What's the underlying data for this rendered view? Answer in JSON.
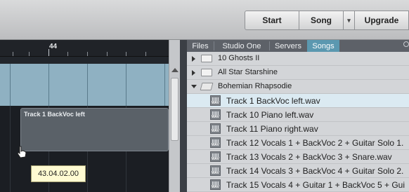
{
  "toolbar": {
    "start_label": "Start",
    "song_label": "Song",
    "dropdown_glyph": "▾",
    "upgrade_label": "Upgrade"
  },
  "timeline": {
    "ruler_label": "44",
    "clip_label": "Track 1 BackVoc left",
    "tooltip": "43.04.02.00"
  },
  "browser": {
    "tabs": [
      {
        "label": "Files"
      },
      {
        "label": "Studio One"
      },
      {
        "label": "Servers"
      },
      {
        "label": "Songs",
        "active": true
      }
    ],
    "folders": [
      {
        "label": "10 Ghosts II",
        "expanded": false
      },
      {
        "label": "All Star Starshine",
        "expanded": false
      },
      {
        "label": "Bohemian Rhapsodie",
        "expanded": true
      }
    ],
    "files": [
      {
        "label": "Track 1 BackVoc left.wav",
        "selected": true
      },
      {
        "label": "Track 10 Piano left.wav"
      },
      {
        "label": "Track 11 Piano right.wav"
      },
      {
        "label": "Track 12 Vocals 1 + BackVoc 2 + Guitar Solo 1."
      },
      {
        "label": "Track 13 Vocals 2 + BackVoc 3 + Snare.wav"
      },
      {
        "label": "Track 14 Vocals 3 + BackVoc 4 + Guitar Solo 2."
      },
      {
        "label": "Track 15 Vocals 4 + Guitar 1 + BackVoc 5 + Gui"
      }
    ],
    "file_icon_text": "WAV"
  },
  "colors": {
    "active_tab": "#5b98b0",
    "track_lane": "#8fb1c2",
    "tooltip_bg": "#fffbd2"
  }
}
